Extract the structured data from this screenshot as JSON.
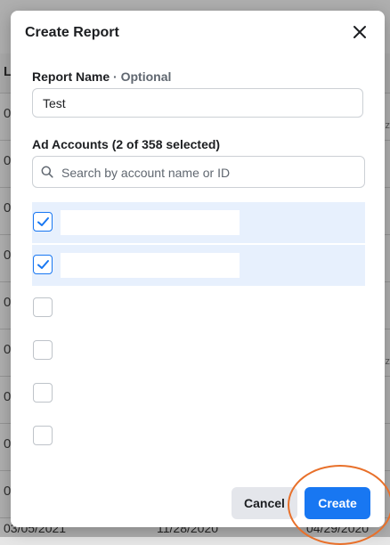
{
  "background": {
    "header_letter": "L",
    "row_cells": [
      "0",
      "0",
      "0",
      "0",
      "0",
      "0",
      "0",
      "0",
      "0",
      "0"
    ],
    "right_fragments": [
      "ez",
      "ez"
    ],
    "footer": [
      "03/05/2021",
      "11/28/2020",
      "04/29/2020"
    ]
  },
  "modal": {
    "title": "Create Report",
    "report_name": {
      "label": "Report Name",
      "separator": " · ",
      "optional": "Optional",
      "value": "Test"
    },
    "ad_accounts": {
      "label": "Ad Accounts (2 of 358 selected)",
      "search_placeholder": "Search by account name or ID",
      "items": [
        {
          "checked": true
        },
        {
          "checked": true
        },
        {
          "checked": false
        },
        {
          "checked": false
        },
        {
          "checked": false
        },
        {
          "checked": false
        }
      ]
    },
    "buttons": {
      "cancel": "Cancel",
      "create": "Create"
    }
  },
  "colors": {
    "primary": "#1877f2",
    "selected_row": "#e7f0fd",
    "annotation": "#e8702a"
  },
  "icons": [
    "close-icon",
    "search-icon",
    "checkmark-icon"
  ]
}
